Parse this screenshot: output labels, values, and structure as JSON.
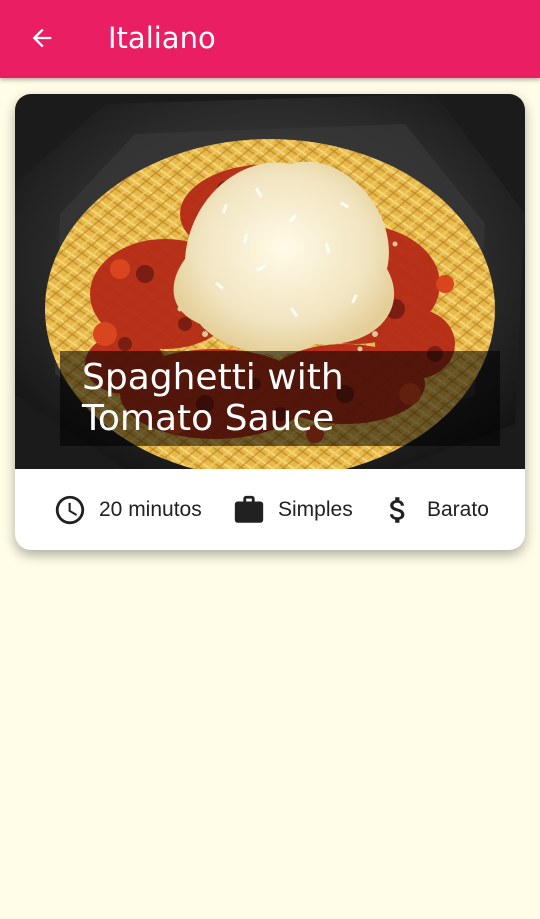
{
  "app_bar": {
    "title": "Italiano",
    "back_icon": "arrow-back-icon",
    "background_color": "#E91E63"
  },
  "page": {
    "background_color": "#FFFDE7"
  },
  "meal_card": {
    "title": "Spaghetti with Tomato Sauce",
    "image": "spaghetti-with-tomato-sauce-photo",
    "info": {
      "duration": {
        "icon": "clock-icon",
        "label": "20 minutos"
      },
      "complexity": {
        "icon": "briefcase-icon",
        "label": "Simples"
      },
      "affordability": {
        "icon": "dollar-icon",
        "label": "Barato"
      }
    }
  }
}
